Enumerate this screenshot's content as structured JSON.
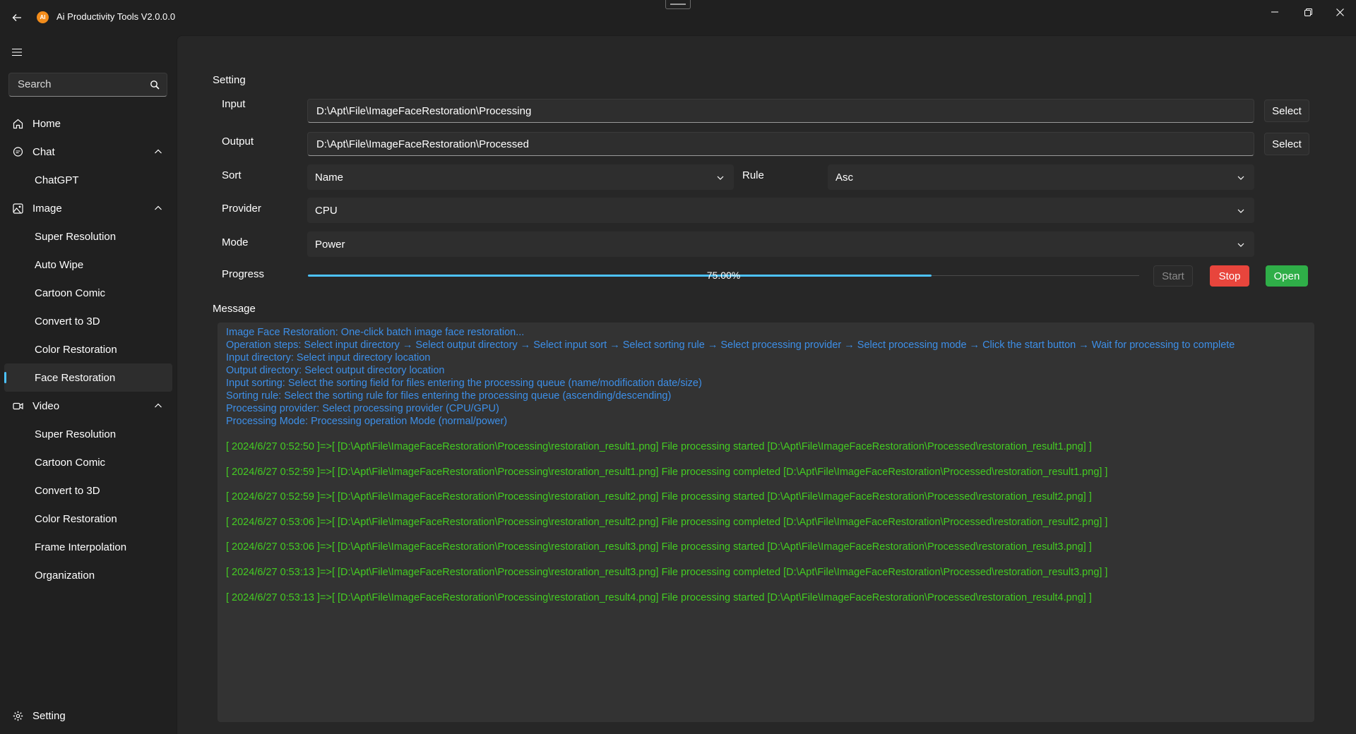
{
  "app": {
    "title": "Ai Productivity Tools V2.0.0.0",
    "logo_text": "AI"
  },
  "sidebar": {
    "search_placeholder": "Search",
    "items": [
      {
        "label": "Home",
        "icon": "home-icon"
      },
      {
        "label": "Chat",
        "icon": "chat-icon",
        "expanded": true
      },
      {
        "label": "ChatGPT"
      },
      {
        "label": "Image",
        "icon": "image-icon",
        "expanded": true
      },
      {
        "label": "Super Resolution"
      },
      {
        "label": "Auto Wipe"
      },
      {
        "label": "Cartoon Comic"
      },
      {
        "label": "Convert to 3D"
      },
      {
        "label": "Color Restoration"
      },
      {
        "label": "Face Restoration",
        "active": true
      },
      {
        "label": "Video",
        "icon": "video-icon",
        "expanded": true
      },
      {
        "label": "Super Resolution"
      },
      {
        "label": "Cartoon Comic"
      },
      {
        "label": "Convert to 3D"
      },
      {
        "label": "Color Restoration"
      },
      {
        "label": "Frame Interpolation"
      },
      {
        "label": "Organization"
      }
    ],
    "setting_label": "Setting"
  },
  "setting": {
    "title": "Setting",
    "input_label": "Input",
    "input_value": "D:\\Apt\\File\\ImageFaceRestoration\\Processing",
    "output_label": "Output",
    "output_value": "D:\\Apt\\File\\ImageFaceRestoration\\Processed",
    "select_label": "Select",
    "sort_label": "Sort",
    "sort_value": "Name",
    "rule_label": "Rule",
    "rule_value": "Asc",
    "provider_label": "Provider",
    "provider_value": "CPU",
    "mode_label": "Mode",
    "mode_value": "Power",
    "progress_label": "Progress",
    "progress_value": 0.75,
    "progress_text": "75.00%",
    "start_label": "Start",
    "stop_label": "Stop",
    "open_label": "Open"
  },
  "message": {
    "title": "Message",
    "info_lines": [
      "Image Face Restoration: One-click batch image face restoration...",
      "Operation steps: Select input directory → Select output directory → Select input sort → Select sorting rule → Select processing provider → Select processing mode → Click the start button → Wait for processing to complete",
      "Input directory: Select input directory location",
      "Output directory: Select output directory location",
      "Input sorting: Select the sorting field for files entering the processing queue (name/modification date/size)",
      "Sorting rule: Select the sorting rule for files entering the processing queue (ascending/descending)",
      "Processing provider: Select processing provider (CPU/GPU)",
      "Processing Mode: Processing operation Mode (normal/power)"
    ],
    "log_lines": [
      "[ 2024/6/27 0:52:50 ]=>[ [D:\\Apt\\File\\ImageFaceRestoration\\Processing\\restoration_result1.png] File processing started [D:\\Apt\\File\\ImageFaceRestoration\\Processed\\restoration_result1.png] ]",
      "[ 2024/6/27 0:52:59 ]=>[ [D:\\Apt\\File\\ImageFaceRestoration\\Processing\\restoration_result1.png] File processing completed [D:\\Apt\\File\\ImageFaceRestoration\\Processed\\restoration_result1.png] ]",
      "[ 2024/6/27 0:52:59 ]=>[ [D:\\Apt\\File\\ImageFaceRestoration\\Processing\\restoration_result2.png] File processing started [D:\\Apt\\File\\ImageFaceRestoration\\Processed\\restoration_result2.png] ]",
      "[ 2024/6/27 0:53:06 ]=>[ [D:\\Apt\\File\\ImageFaceRestoration\\Processing\\restoration_result2.png] File processing completed [D:\\Apt\\File\\ImageFaceRestoration\\Processed\\restoration_result2.png] ]",
      "[ 2024/6/27 0:53:06 ]=>[ [D:\\Apt\\File\\ImageFaceRestoration\\Processing\\restoration_result3.png] File processing started [D:\\Apt\\File\\ImageFaceRestoration\\Processed\\restoration_result3.png] ]",
      "[ 2024/6/27 0:53:13 ]=>[ [D:\\Apt\\File\\ImageFaceRestoration\\Processing\\restoration_result3.png] File processing completed [D:\\Apt\\File\\ImageFaceRestoration\\Processed\\restoration_result3.png] ]",
      "[ 2024/6/27 0:53:13 ]=>[ [D:\\Apt\\File\\ImageFaceRestoration\\Processing\\restoration_result4.png] File processing started [D:\\Apt\\File\\ImageFaceRestoration\\Processed\\restoration_result4.png] ]"
    ]
  },
  "colors": {
    "accent": "#4cc2ff",
    "info_text": "#3d8fe8",
    "log_text": "#44cc22",
    "stop": "#e8453c",
    "open": "#2fae48"
  }
}
